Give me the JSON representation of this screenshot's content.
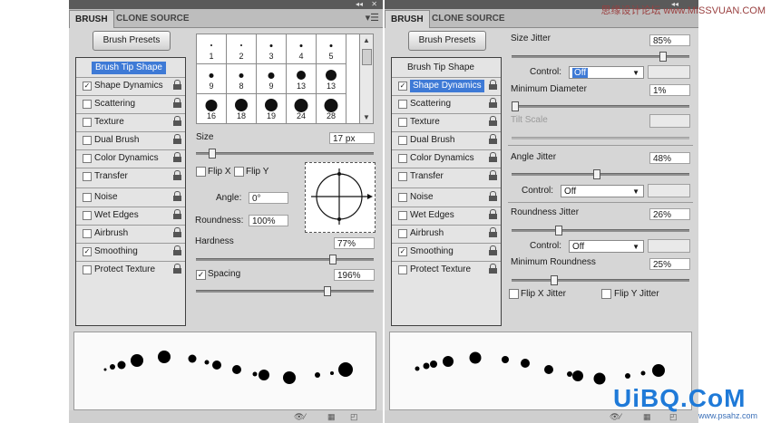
{
  "left": {
    "tabs": [
      "BRUSH",
      "CLONE SOURCE"
    ],
    "presets_button": "Brush Presets",
    "options": [
      {
        "label": "Brush Tip Shape",
        "checked": null,
        "style": "heading-selected"
      },
      {
        "label": "Shape Dynamics",
        "checked": true
      },
      {
        "label": "Scattering",
        "checked": false
      },
      {
        "label": "Texture",
        "checked": false
      },
      {
        "label": "Dual Brush",
        "checked": false
      },
      {
        "label": "Color Dynamics",
        "checked": false
      },
      {
        "label": "Transfer",
        "checked": false
      },
      {
        "label": "Noise",
        "checked": false
      },
      {
        "label": "Wet Edges",
        "checked": false
      },
      {
        "label": "Airbrush",
        "checked": false
      },
      {
        "label": "Smoothing",
        "checked": true
      },
      {
        "label": "Protect Texture",
        "checked": false
      }
    ],
    "tips": [
      {
        "num": "1",
        "size": 2
      },
      {
        "num": "2",
        "size": 2
      },
      {
        "num": "3",
        "size": 3
      },
      {
        "num": "4",
        "size": 3
      },
      {
        "num": "5",
        "size": 3
      },
      {
        "num": "9",
        "size": 5
      },
      {
        "num": "8",
        "size": 5
      },
      {
        "num": "9",
        "size": 7
      },
      {
        "num": "13",
        "size": 10
      },
      {
        "num": "13",
        "size": 12
      },
      {
        "num": "16",
        "size": 13
      },
      {
        "num": "18",
        "size": 14
      },
      {
        "num": "19",
        "size": 14
      },
      {
        "num": "24",
        "size": 15
      },
      {
        "num": "28",
        "size": 15
      }
    ],
    "size_label": "Size",
    "size_value": "17 px",
    "flipx": "Flip X",
    "flipy": "Flip Y",
    "angle_label": "Angle:",
    "angle_value": "0°",
    "roundness_label": "Roundness:",
    "roundness_value": "100%",
    "hardness_label": "Hardness",
    "hardness_value": "77%",
    "spacing_label": "Spacing",
    "spacing_value": "196%",
    "spacing_checked": true
  },
  "right": {
    "tabs": [
      "BRUSH",
      "CLONE SOURCE"
    ],
    "presets_button": "Brush Presets",
    "options": [
      {
        "label": "Brush Tip Shape",
        "checked": null,
        "style": "heading"
      },
      {
        "label": "Shape Dynamics",
        "checked": true,
        "style": "selected"
      },
      {
        "label": "Scattering",
        "checked": false
      },
      {
        "label": "Texture",
        "checked": false
      },
      {
        "label": "Dual Brush",
        "checked": false
      },
      {
        "label": "Color Dynamics",
        "checked": false
      },
      {
        "label": "Transfer",
        "checked": false
      },
      {
        "label": "Noise",
        "checked": false
      },
      {
        "label": "Wet Edges",
        "checked": false
      },
      {
        "label": "Airbrush",
        "checked": false
      },
      {
        "label": "Smoothing",
        "checked": true
      },
      {
        "label": "Protect Texture",
        "checked": false
      }
    ],
    "size_jitter_label": "Size Jitter",
    "size_jitter_value": "85%",
    "control_label": "Control:",
    "control_value_1": "Off",
    "min_diameter_label": "Minimum Diameter",
    "min_diameter_value": "1%",
    "tilt_scale_label": "Tilt Scale",
    "angle_jitter_label": "Angle Jitter",
    "angle_jitter_value": "48%",
    "control_value_2": "Off",
    "roundness_jitter_label": "Roundness Jitter",
    "roundness_jitter_value": "26%",
    "control_value_3": "Off",
    "min_roundness_label": "Minimum Roundness",
    "min_roundness_value": "25%",
    "flip_x_jitter": "Flip X Jitter",
    "flip_y_jitter": "Flip Y Jitter"
  },
  "watermark": {
    "top": "思缘设计论坛 www.MISSVUAN.COM",
    "logo": "UiBQ.CoM",
    "url": "www.psahz.com"
  },
  "colors": {
    "panel": "#d6d6d6",
    "selection": "#3e7ad6",
    "list_border": "#404040"
  }
}
